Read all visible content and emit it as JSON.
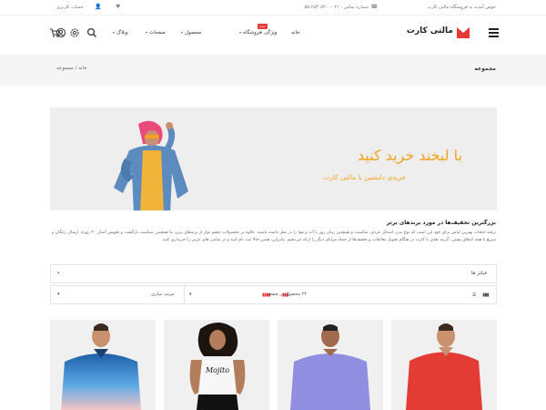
{
  "topbar": {
    "welcome": "خوش آمدید به فروشگاه مالتی کارت",
    "phone": "شماره تماس : ۰۲۱-۶۵۳۰۵۲۰۰-۵۵",
    "account": "حساب کاربری",
    "heart_icon": "heart-icon",
    "user_icon": "user-icon"
  },
  "header": {
    "logo": "مالتی کارت",
    "nav": {
      "home": "خانه",
      "shop": "فروشگاه",
      "special": "ویژگی",
      "product": "محصول",
      "pages": "صفحات",
      "blog": "وبلاگ"
    },
    "badge": "جدید",
    "icons": [
      "search-icon",
      "gear-icon",
      "user-circle-icon",
      "cart-icon"
    ]
  },
  "breadcrumb": {
    "title": "مجموعه",
    "home": "خانه",
    "separator": "/",
    "current": "مجموعه"
  },
  "banner": {
    "title": "با لبخند خرید کنید",
    "subtitle": "خریدی دلنشین با مالتی کارت"
  },
  "description": {
    "title": "بزرگترین تخفیف‌ها در مورد برندهای برتر",
    "body": "ترفند انتخاب بهترین لباس برای خود این است که نوع بدن، استایل فردی، مناسبت و همچنین زمان روز یا آب و هوا را در نظر داشته باشید. علاوه بر محصولات چشم نواز از برندهای برتر، ما همچنین سیاست بازگشت و تعویض آسان ۳۰ روزه، ارسال رایگان و سریع با همه کدهای پستی، گزینه نقدی یا کارت در هنگام تحویل معاملات و تخفیف‌ها از جمله مزایای دیگر را ارائه می‌دهیم. بنابراین، همین حالا ثبت نام کنید و در تمامی های عربی را خریداری کنید."
  },
  "filters": {
    "label": "فیلتر ها",
    "per_page": "۲۴ محصول در صفحه",
    "sort": "مرتب سازی"
  },
  "colors": {
    "accent": "#e53935",
    "banner_text": "#f2a21c",
    "breadcrumb_bg": "#f5f5f5"
  },
  "products": [
    {
      "name": "red-polo-shirt"
    },
    {
      "name": "purple-polo-shirt"
    },
    {
      "name": "mojito-tank-top"
    },
    {
      "name": "gradient-polo-shirt"
    }
  ]
}
